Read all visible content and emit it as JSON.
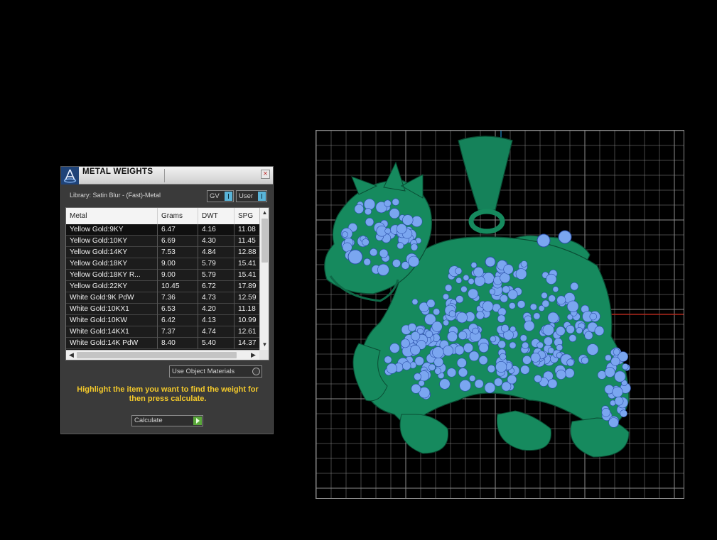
{
  "panel": {
    "title": "METAL WEIGHTS",
    "close_symbol": "×",
    "library_label": "Library: Satin Blur - (Fast)-Metal",
    "toggles": {
      "gv": "GV",
      "user": "User"
    },
    "columns": [
      "Metal",
      "Grams",
      "DWT",
      "SPG"
    ],
    "rows": [
      {
        "metal": "Yellow Gold:9KY",
        "grams": "6.47",
        "dwt": "4.16",
        "spg": "11.08"
      },
      {
        "metal": "Yellow Gold:10KY",
        "grams": "6.69",
        "dwt": "4.30",
        "spg": "11.45"
      },
      {
        "metal": "Yellow Gold:14KY",
        "grams": "7.53",
        "dwt": "4.84",
        "spg": "12.88"
      },
      {
        "metal": "Yellow Gold:18KY",
        "grams": "9.00",
        "dwt": "5.79",
        "spg": "15.41"
      },
      {
        "metal": "Yellow Gold:18KY R...",
        "grams": "9.00",
        "dwt": "5.79",
        "spg": "15.41"
      },
      {
        "metal": "Yellow Gold:22KY",
        "grams": "10.45",
        "dwt": "6.72",
        "spg": "17.89"
      },
      {
        "metal": "White Gold:9K PdW",
        "grams": "7.36",
        "dwt": "4.73",
        "spg": "12.59"
      },
      {
        "metal": "White Gold:10KX1",
        "grams": "6.53",
        "dwt": "4.20",
        "spg": "11.18"
      },
      {
        "metal": "White Gold:10KW",
        "grams": "6.42",
        "dwt": "4.13",
        "spg": "10.99"
      },
      {
        "metal": "White Gold:14KX1",
        "grams": "7.37",
        "dwt": "4.74",
        "spg": "12.61"
      },
      {
        "metal": "White Gold:14K PdW",
        "grams": "8.40",
        "dwt": "5.40",
        "spg": "14.37"
      }
    ],
    "use_object_materials": "Use Object Materials",
    "hint": "Highlight the item you want to find the weight for then press calculate.",
    "calculate_label": "Calculate"
  },
  "viewport": {
    "model": "pendant-lion-3d-model",
    "metal_color": "#168a5e",
    "gem_color": "#7aa6f0",
    "grid_color": "#8c8c8c"
  }
}
